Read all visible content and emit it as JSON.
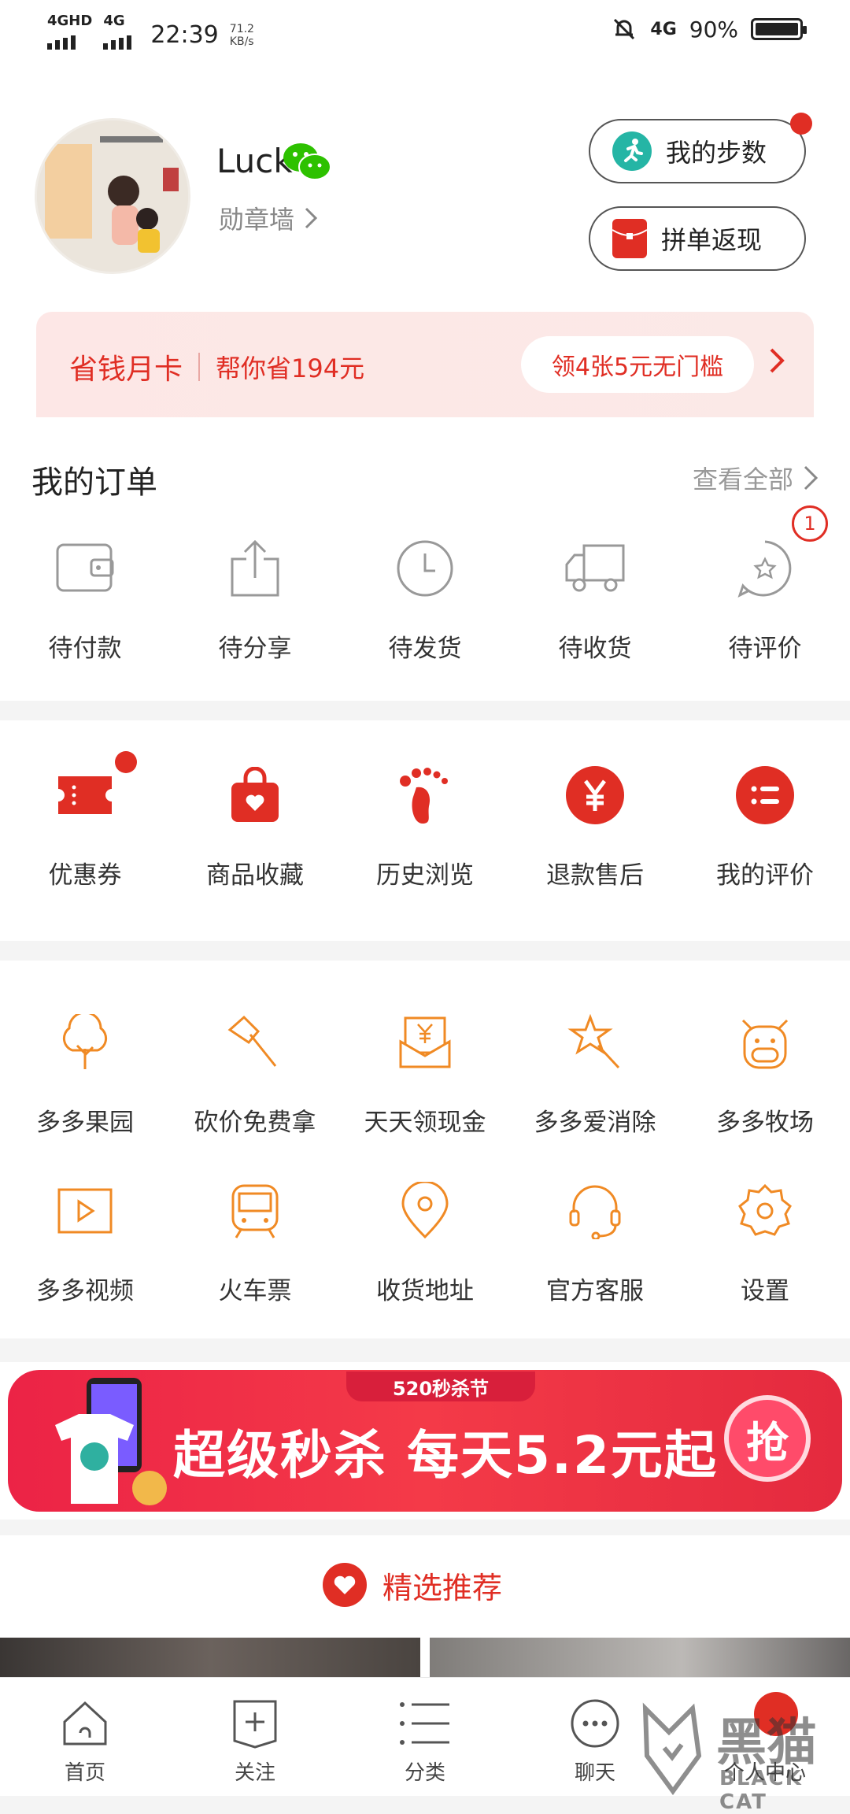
{
  "status_bar": {
    "network1": "4GHD",
    "network2": "4G",
    "time": "22:39",
    "speed": "71.2",
    "speed_unit": "KB/s",
    "network3": "4G",
    "battery": "90%"
  },
  "profile": {
    "username": "Luck",
    "medal_wall": "勋章墙",
    "steps_button": "我的步数",
    "cashback_button": "拼单返现"
  },
  "card": {
    "title": "省钱月卡",
    "subtitle": "帮你省194元",
    "action": "领4张5元无门槛"
  },
  "orders": {
    "title": "我的订单",
    "see_all": "查看全部",
    "items": [
      {
        "label": "待付款",
        "icon": "wallet-icon"
      },
      {
        "label": "待分享",
        "icon": "share-icon"
      },
      {
        "label": "待发货",
        "icon": "clock-icon"
      },
      {
        "label": "待收货",
        "icon": "truck-icon"
      },
      {
        "label": "待评价",
        "icon": "star-bubble-icon",
        "badge": "1"
      }
    ]
  },
  "tools": {
    "items": [
      {
        "label": "优惠券",
        "icon": "coupon-icon"
      },
      {
        "label": "商品收藏",
        "icon": "favorite-bag-icon"
      },
      {
        "label": "历史浏览",
        "icon": "footprint-icon"
      },
      {
        "label": "退款售后",
        "icon": "yen-circle-icon"
      },
      {
        "label": "我的评价",
        "icon": "review-list-icon"
      }
    ]
  },
  "services": {
    "row1": [
      {
        "label": "多多果园",
        "icon": "tree-icon"
      },
      {
        "label": "砍价免费拿",
        "icon": "axe-icon"
      },
      {
        "label": "天天领现金",
        "icon": "yen-envelope-icon"
      },
      {
        "label": "多多爱消除",
        "icon": "star-wand-icon"
      },
      {
        "label": "多多牧场",
        "icon": "cow-icon"
      }
    ],
    "row2": [
      {
        "label": "多多视频",
        "icon": "video-play-icon"
      },
      {
        "label": "火车票",
        "icon": "train-icon"
      },
      {
        "label": "收货地址",
        "icon": "location-pin-icon"
      },
      {
        "label": "官方客服",
        "icon": "headset-icon"
      },
      {
        "label": "设置",
        "icon": "gear-icon"
      }
    ]
  },
  "promo": {
    "tag": "520秒杀节",
    "text": "超级秒杀 每天5.2元起",
    "button": "抢"
  },
  "recommend": {
    "title": "精选推荐"
  },
  "tabbar": {
    "items": [
      {
        "label": "首页",
        "icon": "home-icon"
      },
      {
        "label": "关注",
        "icon": "bookmark-plus-icon"
      },
      {
        "label": "分类",
        "icon": "list-icon"
      },
      {
        "label": "聊天",
        "icon": "chat-icon"
      },
      {
        "label": "个人中心",
        "icon": "profile-icon"
      }
    ]
  },
  "watermark": {
    "text": "黑猫",
    "subtext": "BLACK CAT"
  },
  "colors": {
    "brand_red": "#e02e24",
    "orange_icon": "#f08a24"
  }
}
